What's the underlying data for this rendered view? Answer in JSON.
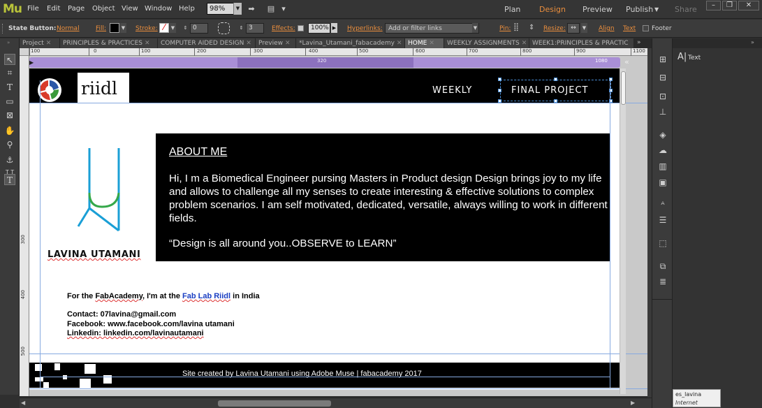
{
  "app": {
    "logo": "Mu"
  },
  "menu": [
    "File",
    "Edit",
    "Page",
    "Object",
    "View",
    "Window",
    "Help"
  ],
  "zoom": "98%",
  "modes": {
    "plan": "Plan",
    "design": "Design",
    "preview": "Preview",
    "publish": "Publish",
    "share": "Share"
  },
  "control_bar": {
    "state_button_label": "State Button:",
    "state_button_value": "Normal",
    "fill_label": "Fill:",
    "stroke_label": "Stroke:",
    "stroke_width": "0",
    "corner_radius": "3",
    "effects_label": "Effects:",
    "opacity": "100%",
    "hyperlinks_label": "Hyperlinks:",
    "hyperlinks_placeholder": "Add or filter links",
    "pin_label": "Pin:",
    "resize_label": "Resize:",
    "align_label": "Align",
    "text_label": "Text",
    "footer_label": "Footer"
  },
  "tabs": [
    {
      "label": "Project",
      "active": false
    },
    {
      "label": "PRINCIPLES & PRACTICES",
      "active": false
    },
    {
      "label": "COMPUTER AIDED DESIGN",
      "active": false
    },
    {
      "label": "Preview",
      "active": false
    },
    {
      "label": "*Lavina_Utamani_fabacademy",
      "active": false
    },
    {
      "label": "HOME",
      "active": true
    },
    {
      "label": "WEEKLY ASSIGNMENTS",
      "active": false
    },
    {
      "label": "WEEK1:PRINCIPLES & PRACTIC",
      "active": false
    }
  ],
  "ruler": {
    "top_labels": [
      "100",
      "0",
      "100",
      "200",
      "300",
      "400",
      "500",
      "600",
      "700",
      "800",
      "900",
      "1000",
      "1100"
    ],
    "left_labels": [
      "300",
      "400",
      "500"
    ]
  },
  "breakpoints": {
    "mid": "320",
    "right": "1080"
  },
  "site": {
    "brand": "riidl",
    "nav": [
      "WEEKLY",
      "FINAL PROJECT"
    ],
    "name": "LAVINA UTAMANI",
    "about_title": "ABOUT ME",
    "about_body": "Hi, I m a Biomedical Engineer pursing Masters in  Product design Design brings joy to my life and allows to challenge all my senses to create interesting & effective solutions to complex problem scenarios. I am self motivated, dedicated, versatile, always willing to work in different fields.",
    "about_quote": "“Design is all around you..OBSERVE to LEARN”",
    "intro_prefix": "For the ",
    "intro_fab": "FabAcademy",
    "intro_mid": ", I'm at the ",
    "intro_lab": "Fab Lab Riidl",
    "intro_suffix": " in India",
    "contact": "Contact: 07lavina@gmail.com",
    "facebook": "Facebook: www.facebook.com/lavina utamani",
    "linkedin": "Linkedin: linkedin.com/lavinautamani",
    "footer": "Site created by Lavina Utamani using Adobe Muse | fabacademy 2017"
  },
  "right_panel": {
    "text_label": "Text"
  },
  "tooltip": {
    "title": "es_lavina",
    "subtitle": "Internet access"
  }
}
